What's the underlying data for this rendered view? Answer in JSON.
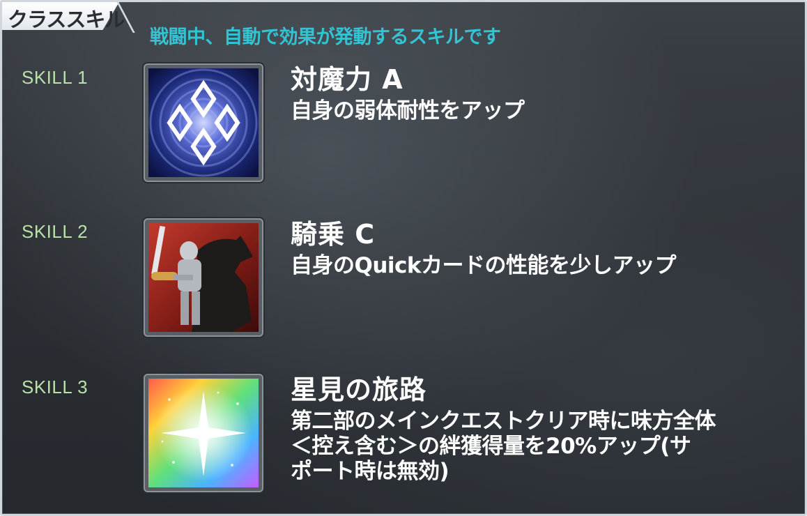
{
  "header": {
    "title": "クラススキル",
    "subtitle": "戦闘中、自動で効果が発動するスキルです"
  },
  "colors": {
    "subtitle": "#33c4d3",
    "skill_label": "#b9e3a6",
    "text": "#ffffff",
    "panel_bg": "#2b2f34"
  },
  "skills": [
    {
      "label": "SKILL 1",
      "name": "対魔力 A",
      "description_lines": [
        "自身の弱体耐性をアップ"
      ],
      "icon": "anti-magic-icon"
    },
    {
      "label": "SKILL 2",
      "name": "騎乗 C",
      "description_lines": [
        "自身のQuickカードの性能を少しアップ"
      ],
      "icon": "riding-knight-icon"
    },
    {
      "label": "SKILL 3",
      "name": "星見の旅路",
      "description_lines": [
        "第二部のメインクエストクリア時に味方全体",
        "＜控え含む＞の絆獲得量を20%アップ(サ",
        "ポート時は無効)"
      ],
      "icon": "starlight-journey-icon"
    }
  ]
}
